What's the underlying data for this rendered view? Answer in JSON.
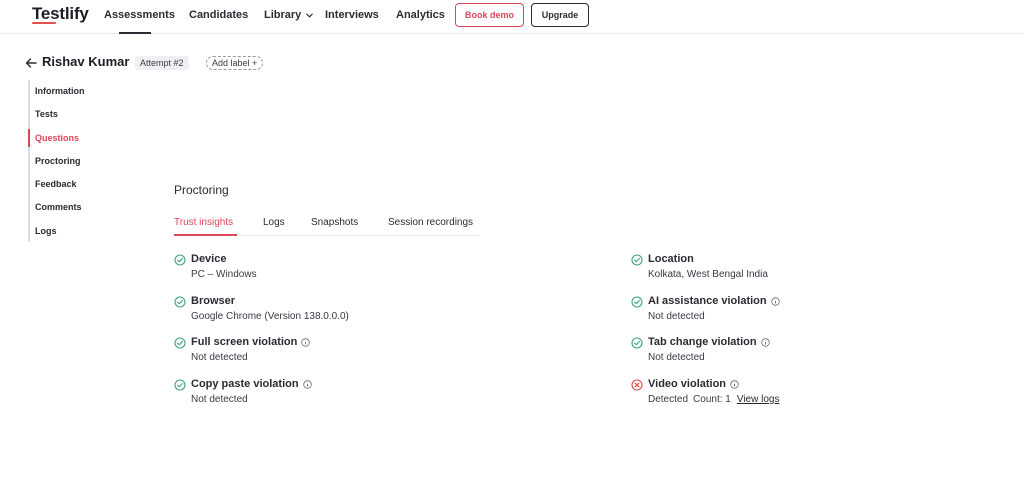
{
  "nav": {
    "logo": "Testlify",
    "items": [
      "Assessments",
      "Candidates",
      "Library",
      "Interviews",
      "Analytics"
    ],
    "book_demo": "Book demo",
    "upgrade": "Upgrade"
  },
  "candidate": {
    "name": "Rishav Kumar",
    "attempt": "Attempt #2",
    "add_label": "Add label +"
  },
  "side_menu": {
    "items": [
      "Information",
      "Tests",
      "Questions",
      "Proctoring",
      "Feedback",
      "Comments",
      "Logs"
    ],
    "active": "Questions"
  },
  "proctoring": {
    "title": "Proctoring",
    "tabs": [
      "Trust insights",
      "Logs",
      "Snapshots",
      "Session recordings"
    ],
    "active_tab": "Trust insights",
    "insights": [
      {
        "title": "Device",
        "value": "PC – Windows",
        "status": "ok"
      },
      {
        "title": "Browser",
        "value": "Google Chrome (Version 138.0.0.0)",
        "status": "ok"
      },
      {
        "title": "Full screen violation",
        "value": "Not detected",
        "status": "ok"
      },
      {
        "title": "Copy paste violation",
        "value": "Not detected",
        "status": "ok"
      },
      {
        "title": "Location",
        "value": "Kolkata, West Bengal India",
        "status": "ok"
      },
      {
        "title": "AI assistance violation",
        "value": "Not detected",
        "status": "ok"
      },
      {
        "title": "Tab change violation",
        "value": "Not detected",
        "status": "ok"
      },
      {
        "title": "Video violation",
        "value": "Detected",
        "count": "Count: 1",
        "link": "View logs",
        "status": "error"
      }
    ]
  },
  "colors": {
    "accent": "#d9485a",
    "ok": "#3aa57a",
    "error": "#e0474c",
    "text": "#2b2b33"
  }
}
